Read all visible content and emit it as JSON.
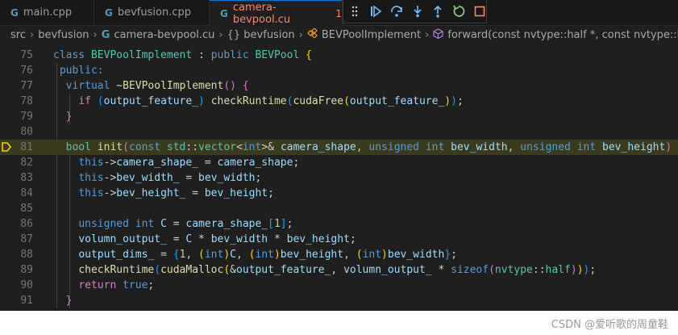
{
  "tabs": [
    {
      "icon": "G",
      "label": "main.cpp"
    },
    {
      "icon": "G",
      "label": "bevfusion.cpp"
    },
    {
      "icon": "G",
      "label": "camera-bevpool.cu",
      "badge": "1"
    }
  ],
  "breadcrumb": {
    "src": "src",
    "folder": "bevfusion",
    "file": "camera-bevpool.cu",
    "namespace": "{} bevfusion",
    "class": "BEVPoolImplement",
    "method": "forward(const nvtype::half *, const nvtype::half *, const u"
  },
  "editor": {
    "line_numbers": [
      "75",
      "76",
      "77",
      "78",
      "79",
      "80",
      "81",
      "82",
      "83",
      "84",
      "85",
      "86",
      "87",
      "88",
      "89",
      "90",
      "91"
    ],
    "current_line": "81"
  },
  "colors": {
    "accent": "#0078d4",
    "breakpoint": "#ffcc00",
    "highlight": "#3a3a1f"
  },
  "icons": {
    "debug": [
      "grip-icon",
      "continue-icon",
      "step-over-icon",
      "step-into-icon",
      "step-out-icon",
      "restart-icon",
      "stop-icon"
    ]
  },
  "watermark": "CSDN @爱听歌的周童鞋"
}
